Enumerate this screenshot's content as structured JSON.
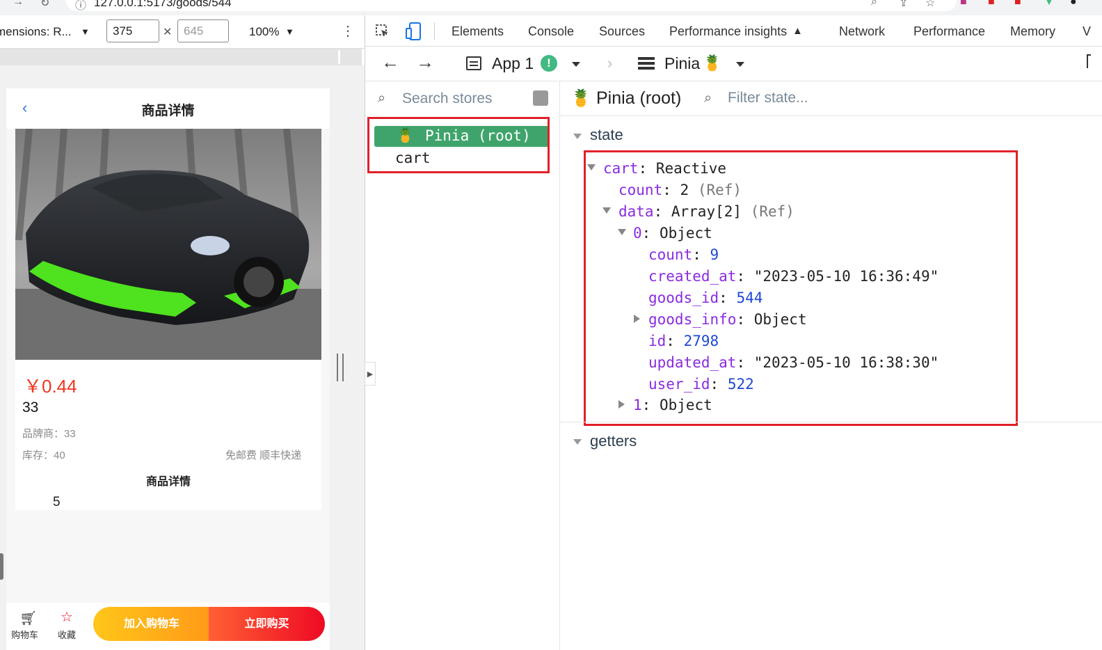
{
  "browser": {
    "url": "127.0.0.1:5173/goods/544"
  },
  "device_toolbar": {
    "dimensions_label": "mensions: R...",
    "width": "375",
    "height": "645",
    "zoom": "100%"
  },
  "mobile_page": {
    "title": "商品详情",
    "price": "￥0.44",
    "name": "33",
    "brand": "品牌商：33",
    "stock": "库存：40",
    "shipping": "免邮费 顺丰快递",
    "detail_heading": "商品详情",
    "detail_value": "5",
    "bottom": {
      "cart_label": "购物车",
      "favorite_label": "收藏",
      "add_to_cart": "加入购物车",
      "buy_now": "立即购买"
    }
  },
  "devtools": {
    "tabs": [
      "Elements",
      "Console",
      "Sources",
      "Performance insights",
      "Network",
      "Performance",
      "Memory",
      "V"
    ],
    "nav": {
      "app_name": "App 1",
      "app_warning": "!",
      "crumb": "Pinia"
    },
    "stores_panel": {
      "search_placeholder": "Search stores",
      "root_store": "Pinia (root)",
      "store_cart": "cart"
    },
    "state_panel": {
      "title": "Pinia (root)",
      "filter_placeholder": "Filter state...",
      "section_state": "state",
      "section_getters": "getters",
      "tree": {
        "cart_key": "cart",
        "cart_val": "Reactive",
        "count_key": "count",
        "count_val": "2",
        "count_type": "(Ref)",
        "data_key": "data",
        "data_val": "Array[2]",
        "data_type": "(Ref)",
        "item0_key": "0",
        "item0_val": "Object",
        "i_count_key": "count",
        "i_count_val": "9",
        "created_key": "created_at",
        "created_val": "\"2023-05-10 16:36:49\"",
        "goods_id_key": "goods_id",
        "goods_id_val": "544",
        "goods_info_key": "goods_info",
        "goods_info_val": "Object",
        "id_key": "id",
        "id_val": "2798",
        "updated_key": "updated_at",
        "updated_val": "\"2023-05-10 16:38:30\"",
        "user_id_key": "user_id",
        "user_id_val": "522",
        "item1_key": "1",
        "item1_val": "Object"
      }
    }
  },
  "colors": {
    "pinia_green": "#3fa46b",
    "highlight_red": "#e0202a",
    "price_red": "#f0351f",
    "key_purple": "#8a2be2",
    "number_blue": "#1f47d6"
  }
}
